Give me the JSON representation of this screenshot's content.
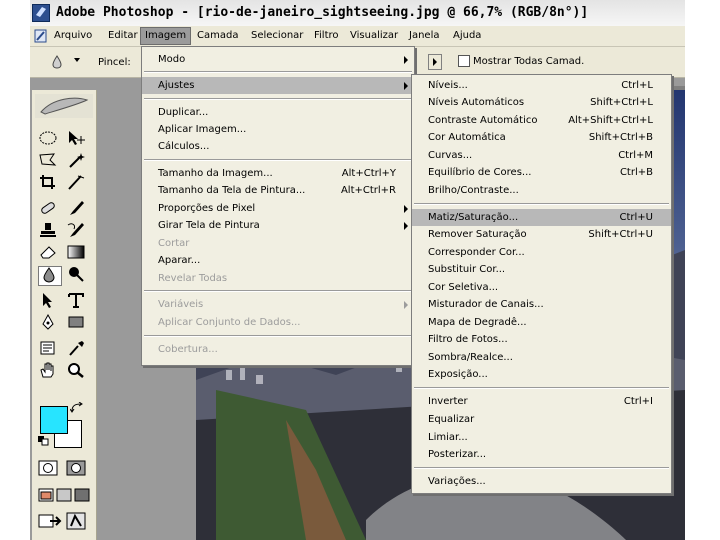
{
  "window": {
    "title": "Adobe Photoshop - [rio-de-janeiro_sightseeing.jpg @ 66,7% (RGB/8n°)]"
  },
  "menubar": {
    "items": [
      "Arquivo",
      "Editar",
      "Imagem",
      "Camada",
      "Selecionar",
      "Filtro",
      "Visualizar",
      "Janela",
      "Ajuda"
    ],
    "active": "Imagem"
  },
  "options_bar": {
    "tool_label": "Pincel:",
    "checkbox_label": "Mostrar Todas Camad."
  },
  "image_menu": {
    "items": [
      {
        "label": "Modo",
        "shortcut": "",
        "submenu": true,
        "disabled": false
      },
      {
        "label": "Ajustes",
        "shortcut": "",
        "submenu": true,
        "disabled": false,
        "highlight": true
      },
      {
        "label": "Duplicar...",
        "shortcut": "",
        "submenu": false,
        "disabled": false
      },
      {
        "label": "Aplicar Imagem...",
        "shortcut": "",
        "submenu": false,
        "disabled": false
      },
      {
        "label": "Cálculos...",
        "shortcut": "",
        "submenu": false,
        "disabled": false
      },
      {
        "label": "Tamanho da Imagem...",
        "shortcut": "Alt+Ctrl+Y",
        "submenu": false,
        "disabled": false
      },
      {
        "label": "Tamanho da Tela de Pintura...",
        "shortcut": "Alt+Ctrl+R",
        "submenu": false,
        "disabled": false
      },
      {
        "label": "Proporções de Pixel",
        "shortcut": "",
        "submenu": true,
        "disabled": false
      },
      {
        "label": "Girar Tela de Pintura",
        "shortcut": "",
        "submenu": true,
        "disabled": false
      },
      {
        "label": "Cortar",
        "shortcut": "",
        "submenu": false,
        "disabled": true
      },
      {
        "label": "Aparar...",
        "shortcut": "",
        "submenu": false,
        "disabled": false
      },
      {
        "label": "Revelar Todas",
        "shortcut": "",
        "submenu": false,
        "disabled": true
      },
      {
        "label": "Variáveis",
        "shortcut": "",
        "submenu": true,
        "disabled": true
      },
      {
        "label": "Aplicar Conjunto de Dados...",
        "shortcut": "",
        "submenu": false,
        "disabled": true
      },
      {
        "label": "Cobertura...",
        "shortcut": "",
        "submenu": false,
        "disabled": true
      }
    ]
  },
  "adjust_menu": {
    "items": [
      {
        "label": "Níveis...",
        "shortcut": "Ctrl+L"
      },
      {
        "label": "Níveis Automáticos",
        "shortcut": "Shift+Ctrl+L"
      },
      {
        "label": "Contraste Automático",
        "shortcut": "Alt+Shift+Ctrl+L"
      },
      {
        "label": "Cor Automática",
        "shortcut": "Shift+Ctrl+B"
      },
      {
        "label": "Curvas...",
        "shortcut": "Ctrl+M"
      },
      {
        "label": "Equilíbrio de Cores...",
        "shortcut": "Ctrl+B"
      },
      {
        "label": "Brilho/Contraste...",
        "shortcut": ""
      },
      {
        "label": "Matiz/Saturação...",
        "shortcut": "Ctrl+U",
        "highlight": true
      },
      {
        "label": "Remover Saturação",
        "shortcut": "Shift+Ctrl+U"
      },
      {
        "label": "Corresponder Cor...",
        "shortcut": ""
      },
      {
        "label": "Substituir Cor...",
        "shortcut": ""
      },
      {
        "label": "Cor Seletiva...",
        "shortcut": ""
      },
      {
        "label": "Misturador de Canais...",
        "shortcut": ""
      },
      {
        "label": "Mapa de Degradê...",
        "shortcut": ""
      },
      {
        "label": "Filtro de Fotos...",
        "shortcut": ""
      },
      {
        "label": "Sombra/Realce...",
        "shortcut": ""
      },
      {
        "label": "Exposição...",
        "shortcut": ""
      },
      {
        "label": "Inverter",
        "shortcut": "Ctrl+I"
      },
      {
        "label": "Equalizar",
        "shortcut": ""
      },
      {
        "label": "Limiar...",
        "shortcut": ""
      },
      {
        "label": "Posterizar...",
        "shortcut": ""
      },
      {
        "label": "Variações...",
        "shortcut": ""
      }
    ]
  },
  "colors": {
    "foreground": "#27e4ff",
    "background": "#ffffff",
    "menu_bg": "#f1efe2",
    "menu_highlight": "#b8b8b8",
    "chrome": "#ece9d8"
  }
}
